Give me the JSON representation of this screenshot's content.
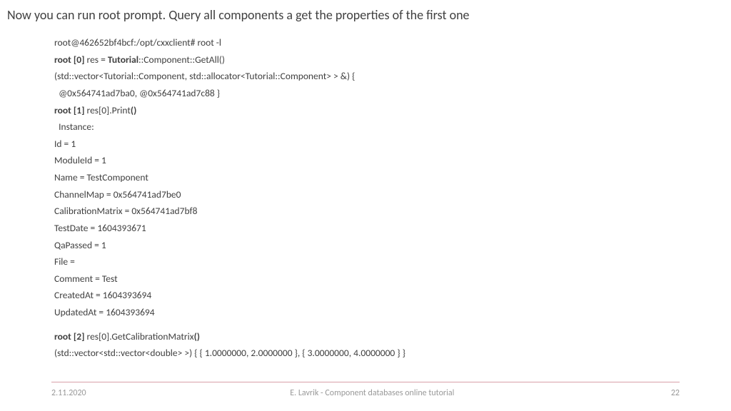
{
  "title": "Now you can run root prompt. Query all components a get the properties of the first one",
  "terminal": {
    "line0": "root@462652bf4bcf:/opt/cxxclient# root -l",
    "line1_pre": "root [0] ",
    "line1_mid": "res = ",
    "line1_bold2": "Tutorial",
    "line1_post": "::Component::GetAll()",
    "line2": "(std::vector<Tutorial::Component, std::allocator<Tutorial::Component> > &) {",
    "line3": "  @0x564741ad7ba0, @0x564741ad7c88 }",
    "line4_pre": "root [1] ",
    "line4_mid": "res[0].Print",
    "line4_post": "()",
    "line5": "  Instance:",
    "line6": "Id = 1",
    "line7": "ModuleId = 1",
    "line8": "Name = TestComponent",
    "line9": "ChannelMap = 0x564741ad7be0",
    "line10": "CalibrationMatrix = 0x564741ad7bf8",
    "line11": "TestDate = 1604393671",
    "line12": "QaPassed = 1",
    "line13": "File =",
    "line14": "Comment = Test",
    "line15": "CreatedAt = 1604393694",
    "line16": "UpdatedAt = 1604393694",
    "line17_pre": "root [2] ",
    "line17_mid": "res[0].GetCalibrationMatrix",
    "line17_post": "()",
    "line18": "(std::vector<std::vector<double> >) { { 1.0000000, 2.0000000 }, { 3.0000000, 4.0000000 } }"
  },
  "footer": {
    "date": "2.11.2020",
    "title": "E. Lavrik - Component databases online tutorial",
    "page": "22"
  }
}
